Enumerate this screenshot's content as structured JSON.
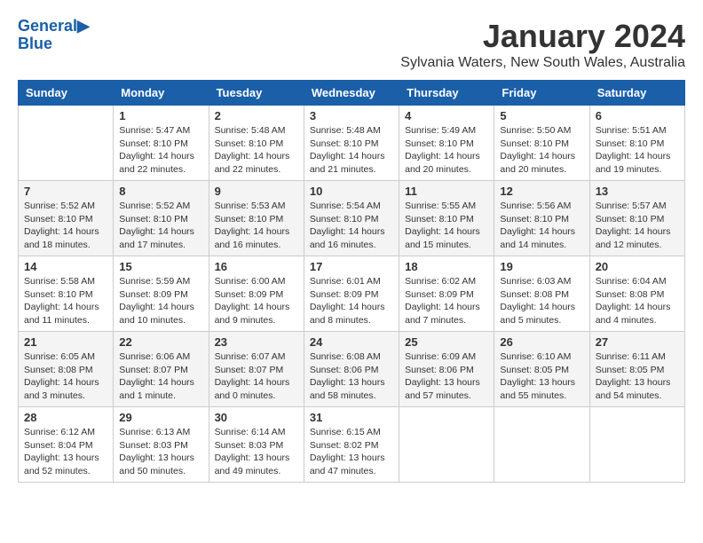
{
  "header": {
    "logo_line1": "General",
    "logo_line2": "Blue",
    "month_title": "January 2024",
    "subtitle": "Sylvania Waters, New South Wales, Australia"
  },
  "weekdays": [
    "Sunday",
    "Monday",
    "Tuesday",
    "Wednesday",
    "Thursday",
    "Friday",
    "Saturday"
  ],
  "weeks": [
    [
      {
        "day": "",
        "info": ""
      },
      {
        "day": "1",
        "info": "Sunrise: 5:47 AM\nSunset: 8:10 PM\nDaylight: 14 hours\nand 22 minutes."
      },
      {
        "day": "2",
        "info": "Sunrise: 5:48 AM\nSunset: 8:10 PM\nDaylight: 14 hours\nand 22 minutes."
      },
      {
        "day": "3",
        "info": "Sunrise: 5:48 AM\nSunset: 8:10 PM\nDaylight: 14 hours\nand 21 minutes."
      },
      {
        "day": "4",
        "info": "Sunrise: 5:49 AM\nSunset: 8:10 PM\nDaylight: 14 hours\nand 20 minutes."
      },
      {
        "day": "5",
        "info": "Sunrise: 5:50 AM\nSunset: 8:10 PM\nDaylight: 14 hours\nand 20 minutes."
      },
      {
        "day": "6",
        "info": "Sunrise: 5:51 AM\nSunset: 8:10 PM\nDaylight: 14 hours\nand 19 minutes."
      }
    ],
    [
      {
        "day": "7",
        "info": "Sunrise: 5:52 AM\nSunset: 8:10 PM\nDaylight: 14 hours\nand 18 minutes."
      },
      {
        "day": "8",
        "info": "Sunrise: 5:52 AM\nSunset: 8:10 PM\nDaylight: 14 hours\nand 17 minutes."
      },
      {
        "day": "9",
        "info": "Sunrise: 5:53 AM\nSunset: 8:10 PM\nDaylight: 14 hours\nand 16 minutes."
      },
      {
        "day": "10",
        "info": "Sunrise: 5:54 AM\nSunset: 8:10 PM\nDaylight: 14 hours\nand 16 minutes."
      },
      {
        "day": "11",
        "info": "Sunrise: 5:55 AM\nSunset: 8:10 PM\nDaylight: 14 hours\nand 15 minutes."
      },
      {
        "day": "12",
        "info": "Sunrise: 5:56 AM\nSunset: 8:10 PM\nDaylight: 14 hours\nand 14 minutes."
      },
      {
        "day": "13",
        "info": "Sunrise: 5:57 AM\nSunset: 8:10 PM\nDaylight: 14 hours\nand 12 minutes."
      }
    ],
    [
      {
        "day": "14",
        "info": "Sunrise: 5:58 AM\nSunset: 8:10 PM\nDaylight: 14 hours\nand 11 minutes."
      },
      {
        "day": "15",
        "info": "Sunrise: 5:59 AM\nSunset: 8:09 PM\nDaylight: 14 hours\nand 10 minutes."
      },
      {
        "day": "16",
        "info": "Sunrise: 6:00 AM\nSunset: 8:09 PM\nDaylight: 14 hours\nand 9 minutes."
      },
      {
        "day": "17",
        "info": "Sunrise: 6:01 AM\nSunset: 8:09 PM\nDaylight: 14 hours\nand 8 minutes."
      },
      {
        "day": "18",
        "info": "Sunrise: 6:02 AM\nSunset: 8:09 PM\nDaylight: 14 hours\nand 7 minutes."
      },
      {
        "day": "19",
        "info": "Sunrise: 6:03 AM\nSunset: 8:08 PM\nDaylight: 14 hours\nand 5 minutes."
      },
      {
        "day": "20",
        "info": "Sunrise: 6:04 AM\nSunset: 8:08 PM\nDaylight: 14 hours\nand 4 minutes."
      }
    ],
    [
      {
        "day": "21",
        "info": "Sunrise: 6:05 AM\nSunset: 8:08 PM\nDaylight: 14 hours\nand 3 minutes."
      },
      {
        "day": "22",
        "info": "Sunrise: 6:06 AM\nSunset: 8:07 PM\nDaylight: 14 hours\nand 1 minute."
      },
      {
        "day": "23",
        "info": "Sunrise: 6:07 AM\nSunset: 8:07 PM\nDaylight: 14 hours\nand 0 minutes."
      },
      {
        "day": "24",
        "info": "Sunrise: 6:08 AM\nSunset: 8:06 PM\nDaylight: 13 hours\nand 58 minutes."
      },
      {
        "day": "25",
        "info": "Sunrise: 6:09 AM\nSunset: 8:06 PM\nDaylight: 13 hours\nand 57 minutes."
      },
      {
        "day": "26",
        "info": "Sunrise: 6:10 AM\nSunset: 8:05 PM\nDaylight: 13 hours\nand 55 minutes."
      },
      {
        "day": "27",
        "info": "Sunrise: 6:11 AM\nSunset: 8:05 PM\nDaylight: 13 hours\nand 54 minutes."
      }
    ],
    [
      {
        "day": "28",
        "info": "Sunrise: 6:12 AM\nSunset: 8:04 PM\nDaylight: 13 hours\nand 52 minutes."
      },
      {
        "day": "29",
        "info": "Sunrise: 6:13 AM\nSunset: 8:03 PM\nDaylight: 13 hours\nand 50 minutes."
      },
      {
        "day": "30",
        "info": "Sunrise: 6:14 AM\nSunset: 8:03 PM\nDaylight: 13 hours\nand 49 minutes."
      },
      {
        "day": "31",
        "info": "Sunrise: 6:15 AM\nSunset: 8:02 PM\nDaylight: 13 hours\nand 47 minutes."
      },
      {
        "day": "",
        "info": ""
      },
      {
        "day": "",
        "info": ""
      },
      {
        "day": "",
        "info": ""
      }
    ]
  ]
}
